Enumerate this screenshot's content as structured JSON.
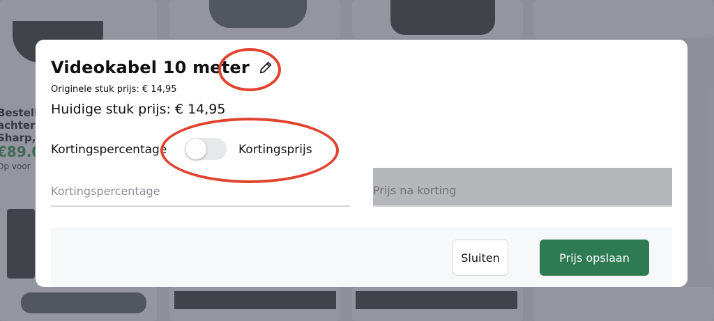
{
  "background": {
    "card_text_lines": [
      "Bestelb",
      "achteru",
      "Sharp,"
    ],
    "card_price": "€89.0",
    "card_note": "Op voor"
  },
  "modal": {
    "title": "Videokabel 10 meter",
    "edit_icon": "pencil-icon",
    "original_price": "Originele stuk prijs: € 14,95",
    "current_price": "Huidige stuk prijs: € 14,95",
    "toggle": {
      "left_label": "Kortingspercentage",
      "right_label": "Kortingsprijs",
      "checked": false
    },
    "fields": {
      "discount_percentage": {
        "placeholder": "Kortingspercentage",
        "value": ""
      },
      "price_after_discount": {
        "placeholder": "Prijs na korting",
        "value": "",
        "disabled": true
      }
    },
    "buttons": {
      "close_label": "Sluiten",
      "save_label": "Prijs opslaan"
    }
  },
  "colors": {
    "primary_button": "#2e7a52",
    "annotation": "#e0432f",
    "price_green": "#3d7a5a"
  }
}
